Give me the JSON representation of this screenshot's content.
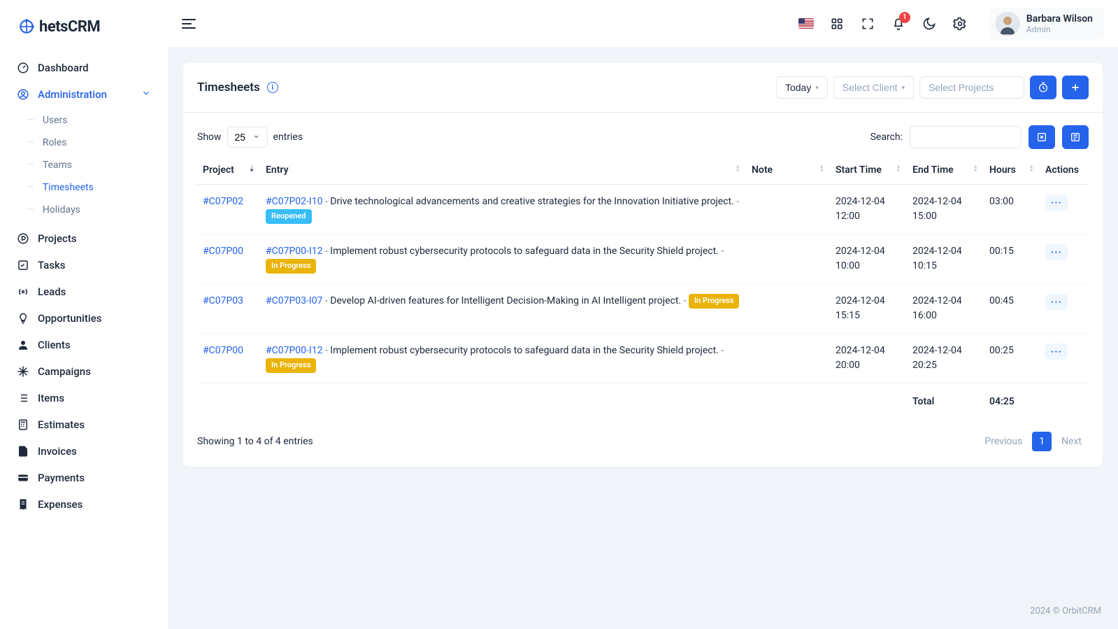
{
  "brand": {
    "name": "hetsCRM"
  },
  "user": {
    "name": "Barbara Wilson",
    "role": "Admin"
  },
  "notifications": {
    "count": "1"
  },
  "sidebar": {
    "dashboard": "Dashboard",
    "administration": "Administration",
    "admin_sub": {
      "users": "Users",
      "roles": "Roles",
      "teams": "Teams",
      "timesheets": "Timesheets",
      "holidays": "Holidays"
    },
    "projects": "Projects",
    "tasks": "Tasks",
    "leads": "Leads",
    "opportunities": "Opportunities",
    "clients": "Clients",
    "campaigns": "Campaigns",
    "items": "Items",
    "estimates": "Estimates",
    "invoices": "Invoices",
    "payments": "Payments",
    "expenses": "Expenses"
  },
  "page": {
    "title": "Timesheets",
    "today_btn": "Today",
    "client_ph": "Select Client",
    "projects_ph": "Select Projects"
  },
  "controls": {
    "show_label": "Show",
    "entries_label": "entries",
    "page_size": "25",
    "search_label": "Search:"
  },
  "columns": {
    "project": "Project",
    "entry": "Entry",
    "note": "Note",
    "start": "Start Time",
    "end": "End Time",
    "hours": "Hours",
    "actions": "Actions"
  },
  "rows": [
    {
      "project_code": "#C07P02",
      "entry_code": "#C07P02-I10",
      "desc": "Drive technological advancements and creative strategies for the Innovation Initiative project.",
      "status": "Reopened",
      "status_variant": "blue",
      "start": "2024-12-04 12:00",
      "end": "2024-12-04 15:00",
      "hours": "03:00"
    },
    {
      "project_code": "#C07P00",
      "entry_code": "#C07P00-I12",
      "desc": "Implement robust cybersecurity protocols to safeguard data in the Security Shield project.",
      "status": "In Progress",
      "status_variant": "yellow",
      "start": "2024-12-04 10:00",
      "end": "2024-12-04 10:15",
      "hours": "00:15"
    },
    {
      "project_code": "#C07P03",
      "entry_code": "#C07P03-I07",
      "desc": "Develop AI-driven features for Intelligent Decision-Making in AI Intelligent project.",
      "status": "In Progress",
      "status_variant": "yellow",
      "start": "2024-12-04 15:15",
      "end": "2024-12-04 16:00",
      "hours": "00:45"
    },
    {
      "project_code": "#C07P00",
      "entry_code": "#C07P00-I12",
      "desc": "Implement robust cybersecurity protocols to safeguard data in the Security Shield project.",
      "status": "In Progress",
      "status_variant": "yellow",
      "start": "2024-12-04 20:00",
      "end": "2024-12-04 20:25",
      "hours": "00:25"
    }
  ],
  "totals": {
    "label": "Total",
    "hours": "04:25"
  },
  "footer_info": "Showing 1 to 4 of 4 entries",
  "pagination": {
    "prev": "Previous",
    "next": "Next",
    "current": "1"
  },
  "footer": "2024 © OrbitCRM"
}
